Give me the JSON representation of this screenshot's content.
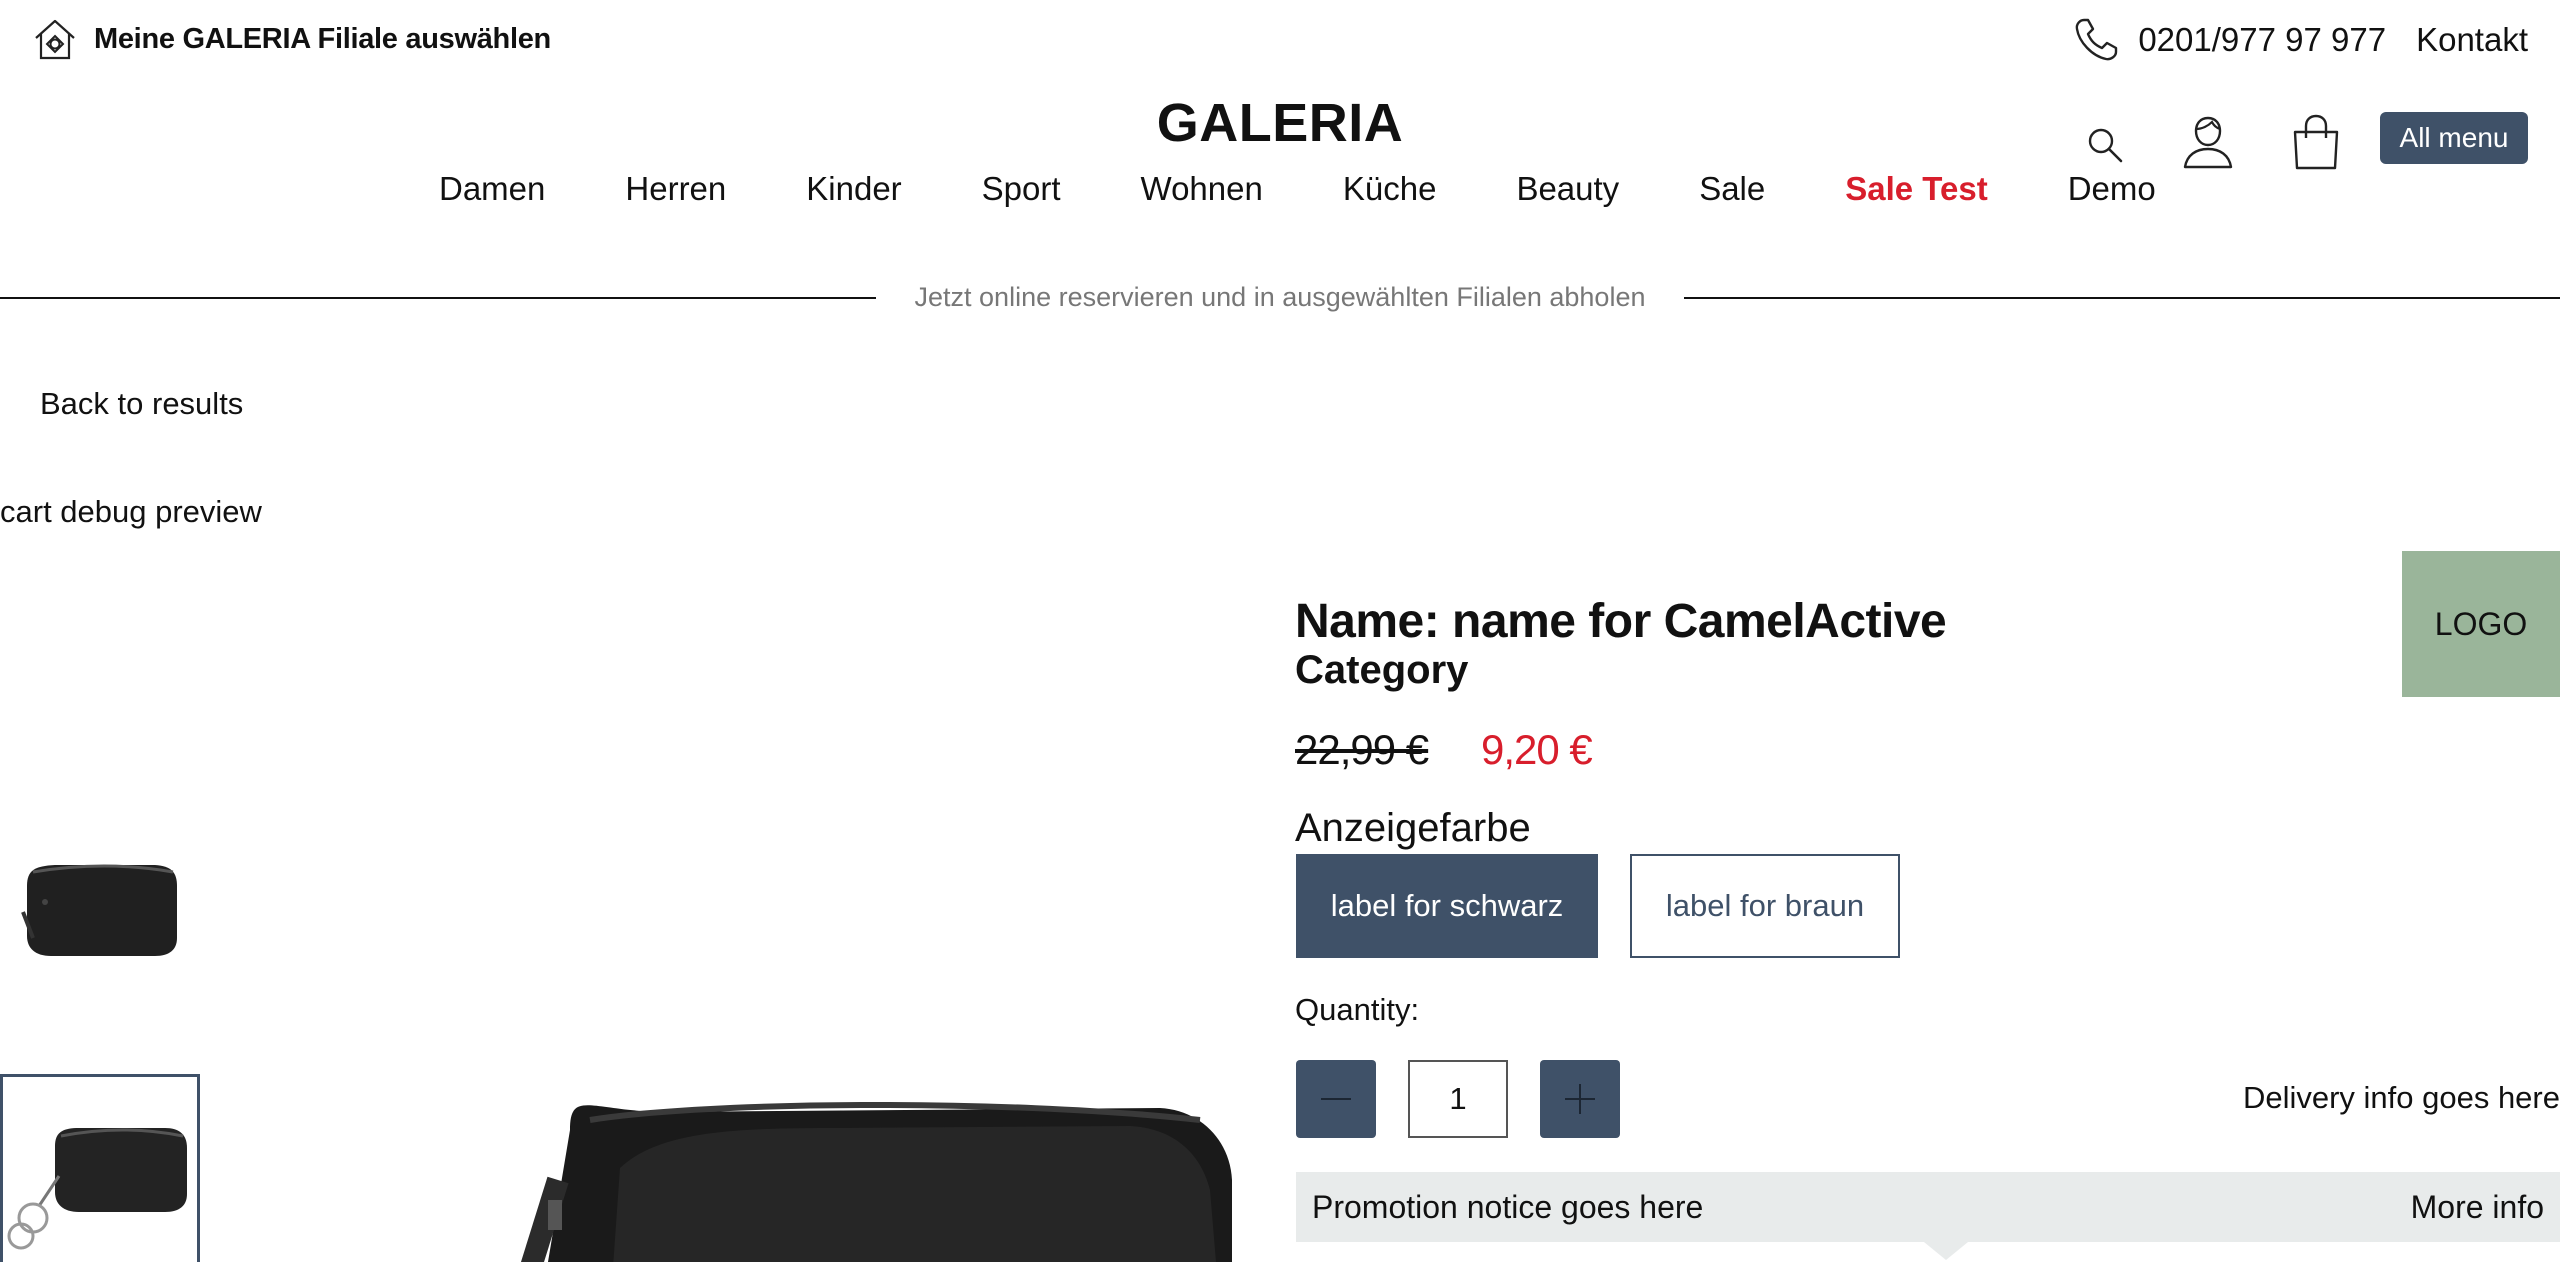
{
  "topbar": {
    "store_label": "Meine GALERIA Filiale auswählen",
    "phone": "0201/977 97 977",
    "contact": "Kontakt"
  },
  "header": {
    "logo": "GALERIA",
    "all_menu": "All menu",
    "nav": [
      {
        "label": "Damen"
      },
      {
        "label": "Herren"
      },
      {
        "label": "Kinder"
      },
      {
        "label": "Sport"
      },
      {
        "label": "Wohnen"
      },
      {
        "label": "Küche"
      },
      {
        "label": "Beauty"
      },
      {
        "label": "Sale"
      },
      {
        "label": "Sale Test"
      },
      {
        "label": "Demo"
      }
    ],
    "icons": [
      "search-icon",
      "user-icon",
      "shopping-bag-icon",
      "store-house-icon",
      "phone-icon"
    ]
  },
  "banner": {
    "text": "Jetzt online reservieren und in ausgewählten Filialen abholen"
  },
  "back_link": "Back to results",
  "debug_text": "cart debug preview",
  "product": {
    "name": "Name: name for CamelActive",
    "category": "Category",
    "old_price": "22,99 €",
    "new_price": "9,20 €",
    "color_label": "Anzeigefarbe",
    "colors": [
      {
        "label": "label for schwarz",
        "selected": true
      },
      {
        "label": "label for braun",
        "selected": false
      }
    ],
    "quantity_label": "Quantity:",
    "quantity_value": "1",
    "delivery": "Delivery info goes here",
    "logo": "LOGO",
    "promo": "Promotion notice goes here",
    "more_info": "More info"
  },
  "colors": {
    "accent": "#3f5168",
    "sale_red": "#d81e2c",
    "logo_box": "#9ab59a",
    "promo_bg": "#e8ebeb"
  }
}
